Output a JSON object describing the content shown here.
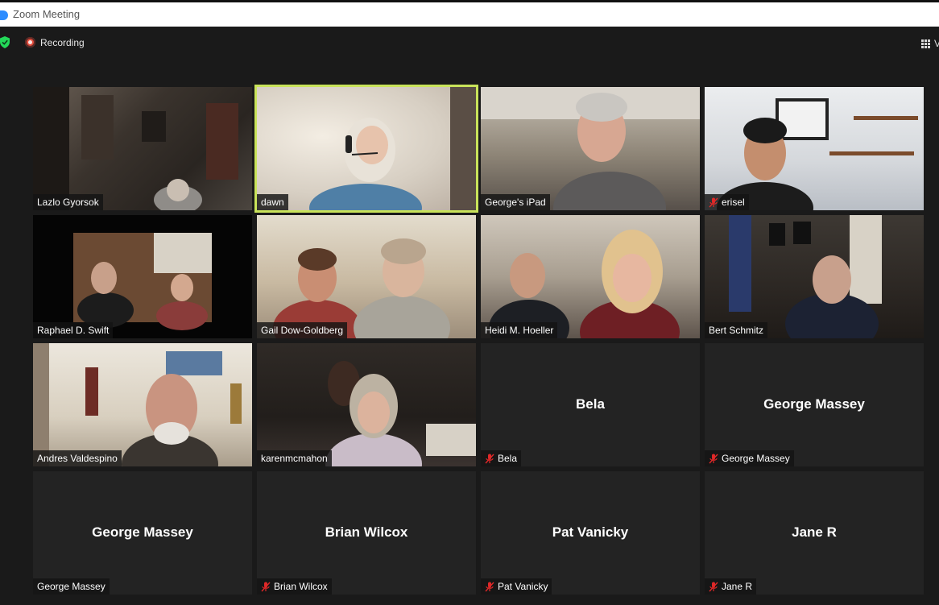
{
  "window": {
    "title": "Zoom Meeting"
  },
  "topbar": {
    "recording_label": "Recording",
    "view_label": "V"
  },
  "colors": {
    "active_speaker_outline": "#c9e35a",
    "recording": "#e24b3b",
    "muted_icon": "#e02828",
    "security": "#23d959"
  },
  "participants": [
    {
      "name": "Lazlo Gyorsok",
      "muted": false,
      "video": true
    },
    {
      "name": "dawn",
      "muted": false,
      "video": true,
      "active_speaker": true
    },
    {
      "name": "George's iPad",
      "muted": false,
      "video": true
    },
    {
      "name": "erisel",
      "muted": true,
      "video": true
    },
    {
      "name": "Raphael D. Swift",
      "muted": false,
      "video": true
    },
    {
      "name": "Gail Dow-Goldberg",
      "muted": false,
      "video": true
    },
    {
      "name": "Heidi M. Hoeller",
      "muted": false,
      "video": true
    },
    {
      "name": "Bert Schmitz",
      "muted": false,
      "video": true
    },
    {
      "name": "Andres Valdespino",
      "muted": false,
      "video": true
    },
    {
      "name": "karenmcmahon",
      "muted": false,
      "video": true
    },
    {
      "name": "Bela",
      "display_name": "Bela",
      "muted": true,
      "video": false
    },
    {
      "name": "George Massey",
      "display_name": "George Massey",
      "muted": true,
      "video": false
    },
    {
      "name": "George Massey",
      "display_name": "George Massey",
      "muted": false,
      "video": false
    },
    {
      "name": "Brian Wilcox",
      "display_name": "Brian Wilcox",
      "muted": true,
      "video": false
    },
    {
      "name": "Pat Vanicky",
      "display_name": "Pat Vanicky",
      "muted": true,
      "video": false
    },
    {
      "name": "Jane R",
      "display_name": "Jane R",
      "muted": true,
      "video": false
    }
  ]
}
